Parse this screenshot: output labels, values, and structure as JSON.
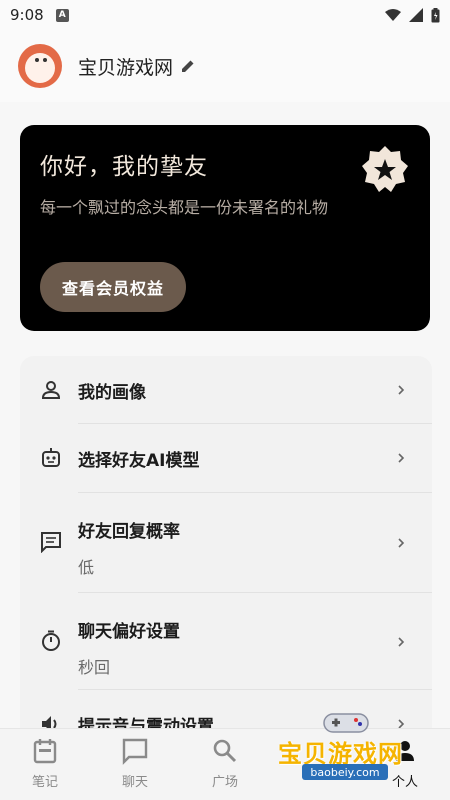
{
  "status_bar": {
    "time": "9:08",
    "notification_letter": "A"
  },
  "header": {
    "app_name": "宝贝游戏网"
  },
  "promo": {
    "title": "你好，我的挚友",
    "subtitle": "每一个飘过的念头都是一份未署名的礼物",
    "button_label": "查看会员权益"
  },
  "settings": {
    "items": [
      {
        "label": "我的画像",
        "value": ""
      },
      {
        "label": "选择好友AI模型",
        "value": ""
      },
      {
        "label": "好友回复概率",
        "value": "低"
      },
      {
        "label": "聊天偏好设置",
        "value": "秒回"
      },
      {
        "label": "提示音与震动设置",
        "value": ""
      }
    ]
  },
  "bottom_nav": {
    "items": [
      {
        "label": "笔记",
        "icon": "notes-icon"
      },
      {
        "label": "聊天",
        "icon": "chat-icon"
      },
      {
        "label": "广场",
        "icon": "search-icon"
      },
      {
        "label": "",
        "icon": ""
      },
      {
        "label": "个人",
        "icon": "profile-icon",
        "active": true
      }
    ]
  },
  "watermark": {
    "text": "宝贝游戏网",
    "url": "baobeiy.com"
  }
}
